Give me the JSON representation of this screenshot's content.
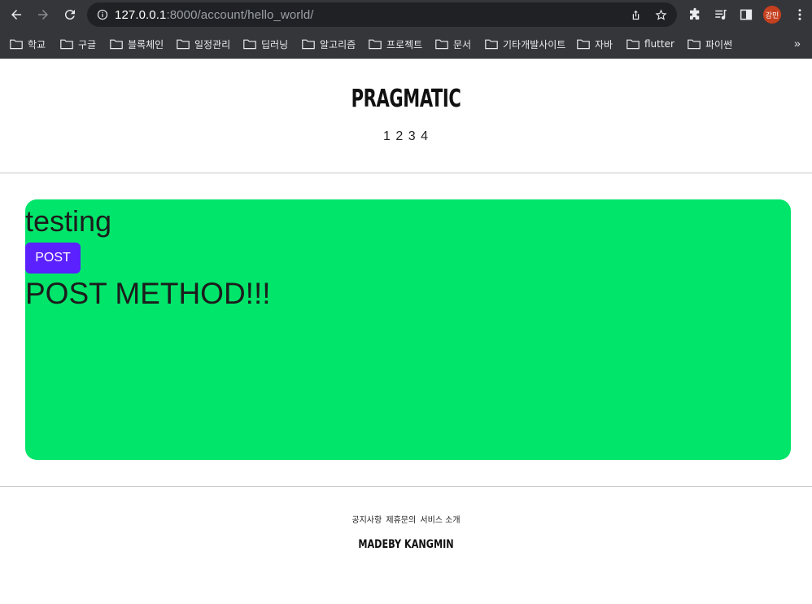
{
  "browser": {
    "url_host": "127.0.0.1",
    "url_path": ":8000/account/hello_world/",
    "avatar_label": "강민",
    "bookmarks": [
      {
        "label": "학교"
      },
      {
        "label": "구글"
      },
      {
        "label": "블록체인"
      },
      {
        "label": "일정관리"
      },
      {
        "label": "딥러닝"
      },
      {
        "label": "알고리즘"
      },
      {
        "label": "프로젝트"
      },
      {
        "label": "문서"
      },
      {
        "label": "기타개발사이트"
      },
      {
        "label": "자바"
      },
      {
        "label": "flutter"
      },
      {
        "label": "파이썬"
      }
    ],
    "more_label": "»"
  },
  "header": {
    "brand": "PRAGMATIC",
    "nav": "1 2 3 4"
  },
  "main": {
    "title": "testing",
    "post_button": "POST",
    "result_text": "POST METHOD!!!",
    "card_color": "#00e56a",
    "button_color": "#5b21ff"
  },
  "footer": {
    "links": [
      "공지사항",
      "제휴문의",
      "서비스 소개"
    ],
    "brand": "MADEBY KANGMIN"
  }
}
